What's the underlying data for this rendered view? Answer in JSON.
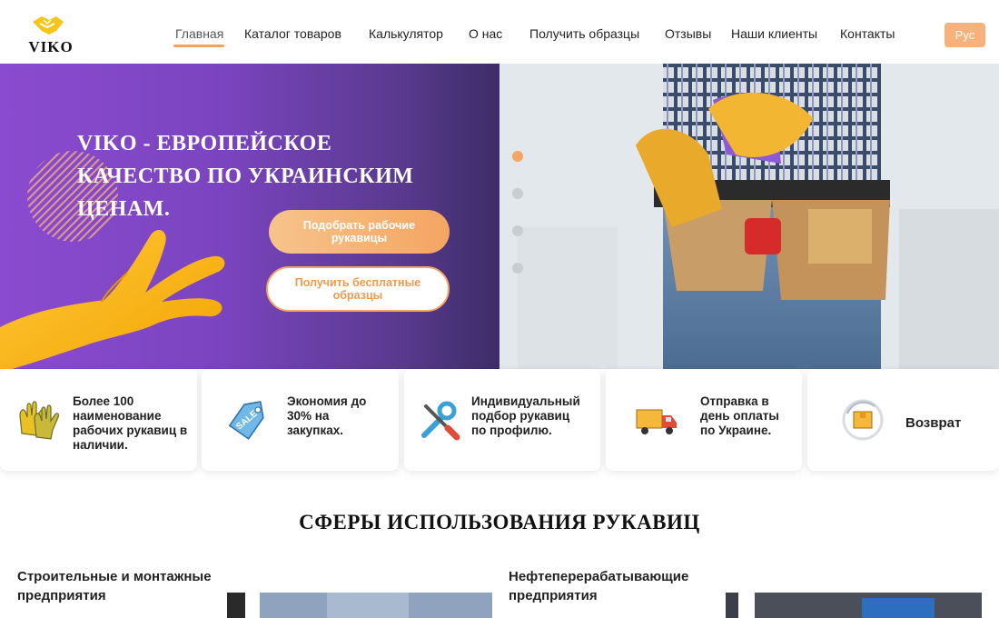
{
  "header": {
    "logo_text": "VIKO",
    "nav": [
      {
        "label": "Главная",
        "active": true
      },
      {
        "label": "Каталог товаров"
      },
      {
        "label": "Калькулятор"
      },
      {
        "label": "О нас"
      },
      {
        "label": "Получить образцы"
      },
      {
        "label": "Отзывы"
      },
      {
        "label": "Наши клиенты"
      },
      {
        "label": "Контакты"
      }
    ],
    "lang_label": "Рус"
  },
  "hero": {
    "title": "Viko - европейское качество по украинским ценам.",
    "primary_button": "Подобрать рабочие рукавицы",
    "secondary_button": "Получить бесплатные образцы",
    "slides_count": 4,
    "active_slide": 1
  },
  "features": [
    {
      "icon": "gloves-icon",
      "text": "Более 100 наименование рабочих рукавиц в наличии."
    },
    {
      "icon": "sale-tag-icon",
      "text": "Экономия до 30% на закупках."
    },
    {
      "icon": "tools-icon",
      "text": "Индивидуальный подбор рукавиц по профилю."
    },
    {
      "icon": "delivery-truck-icon",
      "text": "Отправка в день оплаты по Украине."
    },
    {
      "icon": "return-box-icon",
      "text": "Возврат"
    }
  ],
  "section": {
    "title": "Сферы использования рукавиц",
    "items": [
      {
        "label": "Строительные и монтажные предприятия"
      },
      {
        "label": "Нефтеперерабатывающие предприятия"
      }
    ]
  },
  "colors": {
    "accent": "#f5a562",
    "hero_purple": "#8b4bd0"
  }
}
